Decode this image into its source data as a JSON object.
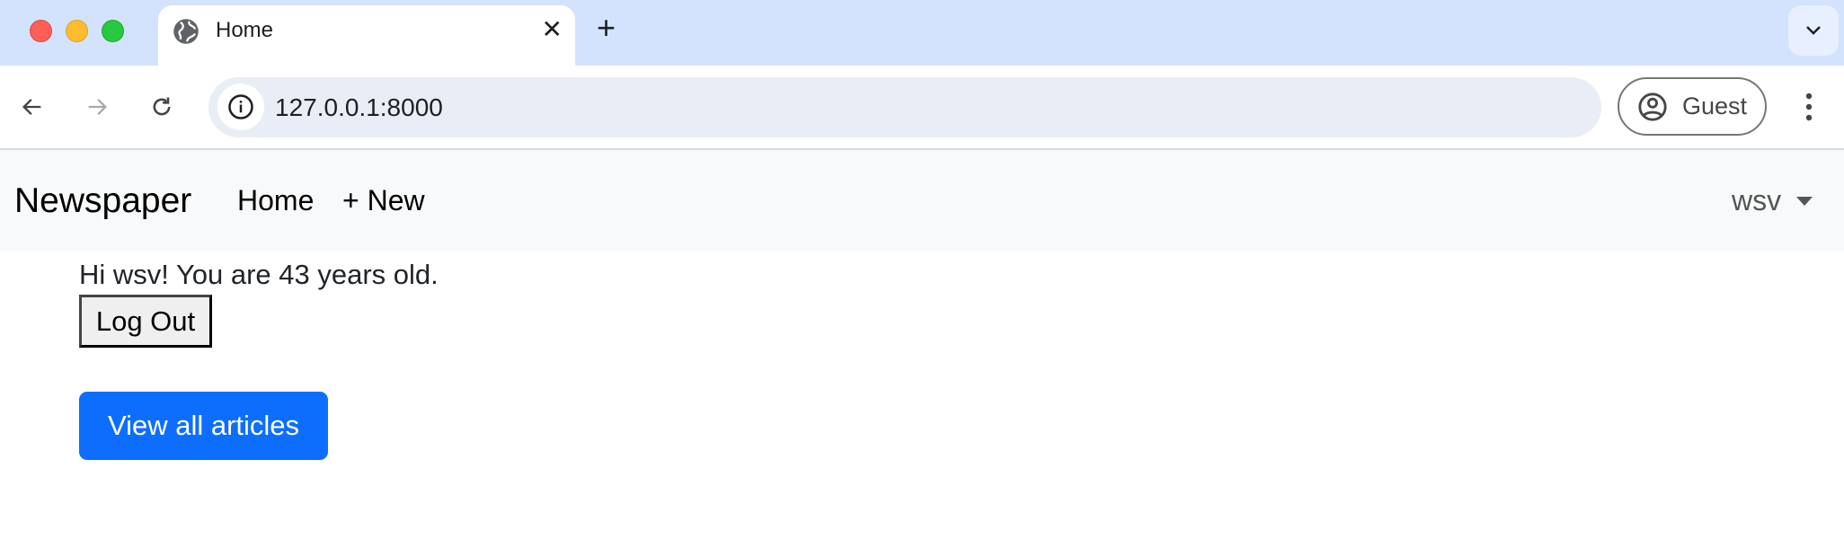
{
  "browser": {
    "tab": {
      "title": "Home",
      "favicon": "globe-icon"
    },
    "new_tab_label": "+",
    "address": "127.0.0.1:8000",
    "profile_label": "Guest",
    "colors": {
      "tabstrip": "#d3e3fd",
      "omnibox": "#e9eef6"
    }
  },
  "navbar": {
    "brand": "Newspaper",
    "links": [
      {
        "label": "Home"
      },
      {
        "label": "+ New"
      }
    ],
    "user": "wsv"
  },
  "main": {
    "greeting": "Hi wsv! You are 43 years old.",
    "logout_label": "Log Out",
    "view_all_label": "View all articles",
    "accent": "#0d6efd"
  }
}
